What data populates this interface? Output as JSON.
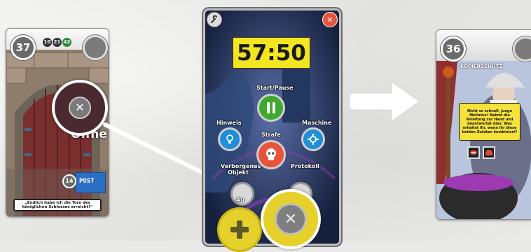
{
  "left_card": {
    "number": "37",
    "mini_tags": [
      "10",
      "21",
      "42"
    ],
    "door_text": "Öffne",
    "overlay_symbol": "✕",
    "mailbox_number": "14",
    "mailbox_label": "POST",
    "quote": "„Endlich habe ich die Tore des königlichen Schlosses erreicht!“"
  },
  "phone": {
    "timer": "57:50",
    "buttons": {
      "start_pause": "Start/Pause",
      "hint": "Hinweis",
      "machine": "Maschine",
      "penalty": "Strafe",
      "hidden_object": "Verborgenes Objekt",
      "protocol": "Protokoll",
      "auto_partial": "Au"
    }
  },
  "right_card": {
    "number": "36",
    "title": "KOPIERSCHUTZ",
    "speech": "Nicht so schnell, junge Mellmiss! Nehmt die Anleitung zur Hand und beantwortet dies: Was erhaltet Ihr, wenn Ihr diese beiden Zutaten kombiniert?"
  },
  "colors": {
    "timer_yellow": "#f2e622",
    "play_green": "#3daa2e",
    "hint_blue": "#1e8fd8",
    "penalty_red": "#e8543b",
    "accent_yellow": "#e5d129",
    "arrow_white": "#ffffff"
  }
}
